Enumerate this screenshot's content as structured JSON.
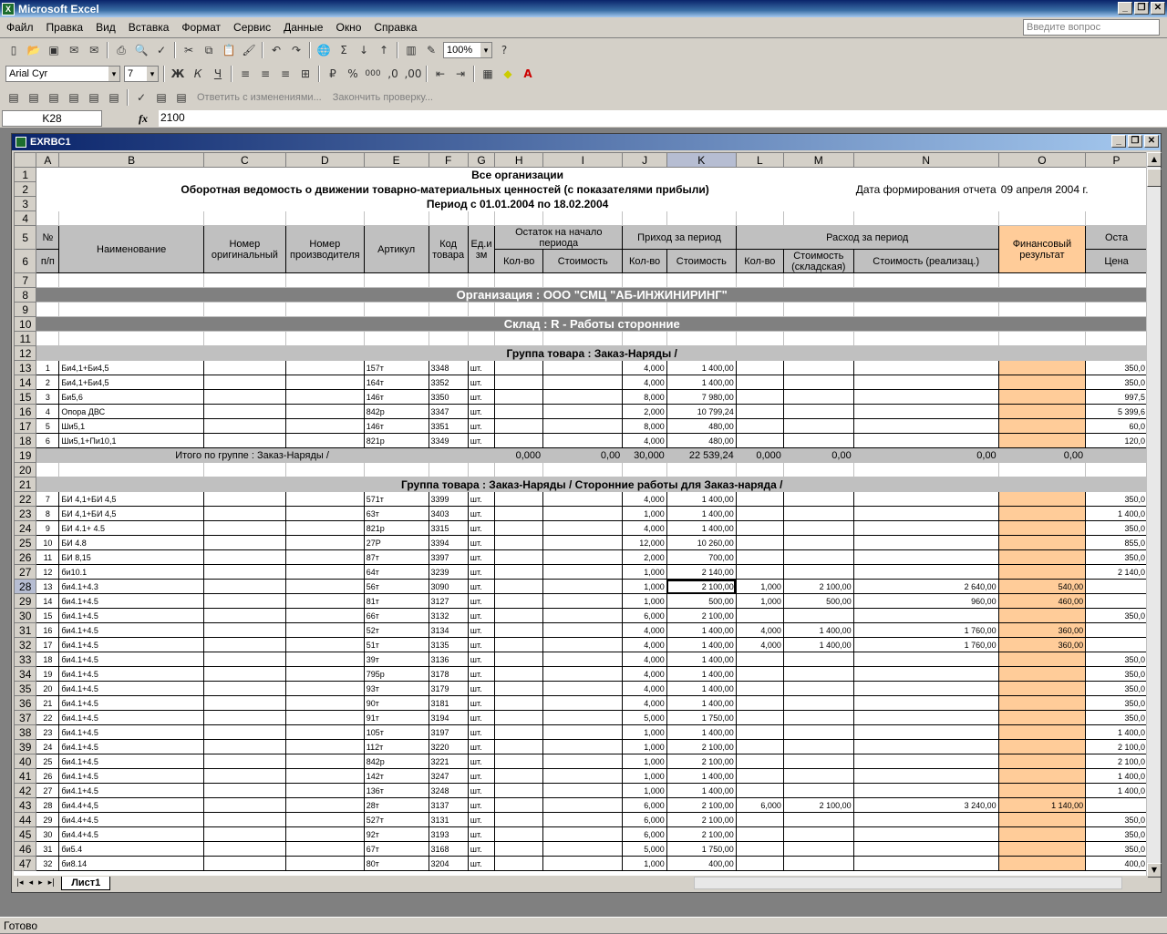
{
  "app": {
    "title": "Microsoft Excel",
    "doc_title": "EXRBC1",
    "status": "Готово",
    "ask_placeholder": "Введите вопрос"
  },
  "menu": [
    "Файл",
    "Правка",
    "Вид",
    "Вставка",
    "Формат",
    "Сервис",
    "Данные",
    "Окно",
    "Справка"
  ],
  "toolbar": {
    "zoom": "100%",
    "font": "Arial Cyr",
    "size": "7",
    "review_reply": "Ответить с изменениями...",
    "review_end": "Закончить проверку..."
  },
  "formula": {
    "cell": "K28",
    "value": "2100",
    "fx": "fx"
  },
  "columns": [
    "A",
    "B",
    "C",
    "D",
    "E",
    "F",
    "G",
    "H",
    "I",
    "J",
    "K",
    "L",
    "M",
    "N",
    "O",
    "P"
  ],
  "sheet_tab": "Лист1",
  "header": {
    "r1": "Все организации",
    "r2": "Оборотная ведомость о движении товарно-материальных ценностей (с показателями прибыли)",
    "r2_date_label": "Дата формирования отчета",
    "r2_date": "09 апреля 2004 г.",
    "r3": "Период с 01.01.2004 по 18.02.2004",
    "no": "№",
    "pp": "п/п",
    "name": "Наименование",
    "orig": "Номер оригинальный",
    "mfr": "Номер производителя",
    "art": "Артикул",
    "code": "Код товара",
    "unit": "Ед.и зм",
    "start": "Остаток на начало периода",
    "in": "Приход за период",
    "out": "Расход за период",
    "fin": "Финансовый результат",
    "end": "Оста",
    "qty": "Кол-во",
    "cost": "Стоимость",
    "cost_wh": "Стоимость (складская)",
    "cost_real": "Стоимость (реализац.)",
    "price": "Цена"
  },
  "org": "Организация : ООО \"СМЦ \"АБ-ИНЖИНИРИНГ\"",
  "warehouse": "Склад : R - Работы сторонние",
  "group1": "Группа товара : Заказ-Наряды /",
  "group2": "Группа товара : Заказ-Наряды / Сторонние работы для Заказ-наряда /",
  "total1": {
    "label": "Итого по группе : Заказ-Наряды /",
    "h": "0,000",
    "i": "0,00",
    "j": "30,000",
    "k": "22 539,24",
    "l": "0,000",
    "m": "0,00",
    "n": "0,00",
    "o": "0,00"
  },
  "rows1": [
    [
      "1",
      "Би4,1+Би4,5",
      "157т",
      "3348",
      "шт.",
      "4,000",
      "1 400,00",
      "",
      "",
      "",
      "",
      "350,0"
    ],
    [
      "2",
      "Би4,1+Би4,5",
      "164т",
      "3352",
      "шт.",
      "4,000",
      "1 400,00",
      "",
      "",
      "",
      "",
      "350,0"
    ],
    [
      "3",
      "Би5,6",
      "146т",
      "3350",
      "шт.",
      "8,000",
      "7 980,00",
      "",
      "",
      "",
      "",
      "997,5"
    ],
    [
      "4",
      "Опора ДВС",
      "842р",
      "3347",
      "шт.",
      "2,000",
      "10 799,24",
      "",
      "",
      "",
      "",
      "5 399,6"
    ],
    [
      "5",
      "Ши5,1",
      "146т",
      "3351",
      "шт.",
      "8,000",
      "480,00",
      "",
      "",
      "",
      "",
      "60,0"
    ],
    [
      "6",
      "Ши5,1+Пи10,1",
      "821р",
      "3349",
      "шт.",
      "4,000",
      "480,00",
      "",
      "",
      "",
      "",
      "120,0"
    ]
  ],
  "rows2": [
    [
      "7",
      "БИ 4,1+БИ 4,5",
      "571т",
      "3399",
      "шт.",
      "4,000",
      "1 400,00",
      "",
      "",
      "",
      "",
      "350,0"
    ],
    [
      "8",
      "БИ 4,1+БИ 4,5",
      "63т",
      "3403",
      "шт.",
      "1,000",
      "1 400,00",
      "",
      "",
      "",
      "",
      "1 400,0"
    ],
    [
      "9",
      "БИ 4.1+ 4.5",
      "821р",
      "3315",
      "шт.",
      "4,000",
      "1 400,00",
      "",
      "",
      "",
      "",
      "350,0"
    ],
    [
      "10",
      "БИ 4.8",
      "27Р",
      "3394",
      "шт.",
      "12,000",
      "10 260,00",
      "",
      "",
      "",
      "",
      "855,0"
    ],
    [
      "11",
      "БИ 8,15",
      "87т",
      "3397",
      "шт.",
      "2,000",
      "700,00",
      "",
      "",
      "",
      "",
      "350,0"
    ],
    [
      "12",
      "би10.1",
      "64т",
      "3239",
      "шт.",
      "1,000",
      "2 140,00",
      "",
      "",
      "",
      "",
      "2 140,0"
    ],
    [
      "13",
      "би4.1+4.3",
      "56т",
      "3090",
      "шт.",
      "1,000",
      "2 100,00",
      "1,000",
      "2 100,00",
      "2 640,00",
      "540,00",
      ""
    ],
    [
      "14",
      "би4.1+4.5",
      "81т",
      "3127",
      "шт.",
      "1,000",
      "500,00",
      "1,000",
      "500,00",
      "960,00",
      "460,00",
      ""
    ],
    [
      "15",
      "би4.1+4.5",
      "66т",
      "3132",
      "шт.",
      "6,000",
      "2 100,00",
      "",
      "",
      "",
      "",
      "350,0"
    ],
    [
      "16",
      "би4.1+4.5",
      "52т",
      "3134",
      "шт.",
      "4,000",
      "1 400,00",
      "4,000",
      "1 400,00",
      "1 760,00",
      "360,00",
      ""
    ],
    [
      "17",
      "би4.1+4.5",
      "51т",
      "3135",
      "шт.",
      "4,000",
      "1 400,00",
      "4,000",
      "1 400,00",
      "1 760,00",
      "360,00",
      ""
    ],
    [
      "18",
      "би4.1+4.5",
      "39т",
      "3136",
      "шт.",
      "4,000",
      "1 400,00",
      "",
      "",
      "",
      "",
      "350,0"
    ],
    [
      "19",
      "би4.1+4.5",
      "795р",
      "3178",
      "шт.",
      "4,000",
      "1 400,00",
      "",
      "",
      "",
      "",
      "350,0"
    ],
    [
      "20",
      "би4.1+4.5",
      "93т",
      "3179",
      "шт.",
      "4,000",
      "1 400,00",
      "",
      "",
      "",
      "",
      "350,0"
    ],
    [
      "21",
      "би4.1+4.5",
      "90т",
      "3181",
      "шт.",
      "4,000",
      "1 400,00",
      "",
      "",
      "",
      "",
      "350,0"
    ],
    [
      "22",
      "би4.1+4.5",
      "91т",
      "3194",
      "шт.",
      "5,000",
      "1 750,00",
      "",
      "",
      "",
      "",
      "350,0"
    ],
    [
      "23",
      "би4.1+4.5",
      "105т",
      "3197",
      "шт.",
      "1,000",
      "1 400,00",
      "",
      "",
      "",
      "",
      "1 400,0"
    ],
    [
      "24",
      "би4.1+4.5",
      "112т",
      "3220",
      "шт.",
      "1,000",
      "2 100,00",
      "",
      "",
      "",
      "",
      "2 100,0"
    ],
    [
      "25",
      "би4.1+4.5",
      "842р",
      "3221",
      "шт.",
      "1,000",
      "2 100,00",
      "",
      "",
      "",
      "",
      "2 100,0"
    ],
    [
      "26",
      "би4.1+4.5",
      "142т",
      "3247",
      "шт.",
      "1,000",
      "1 400,00",
      "",
      "",
      "",
      "",
      "1 400,0"
    ],
    [
      "27",
      "би4.1+4.5",
      "136т",
      "3248",
      "шт.",
      "1,000",
      "1 400,00",
      "",
      "",
      "",
      "",
      "1 400,0"
    ],
    [
      "28",
      "би4.4+4,5",
      "28т",
      "3137",
      "шт.",
      "6,000",
      "2 100,00",
      "6,000",
      "2 100,00",
      "3 240,00",
      "1 140,00",
      ""
    ],
    [
      "29",
      "би4.4+4.5",
      "527т",
      "3131",
      "шт.",
      "6,000",
      "2 100,00",
      "",
      "",
      "",
      "",
      "350,0"
    ],
    [
      "30",
      "би4.4+4.5",
      "92т",
      "3193",
      "шт.",
      "6,000",
      "2 100,00",
      "",
      "",
      "",
      "",
      "350,0"
    ],
    [
      "31",
      "би5.4",
      "67т",
      "3168",
      "шт.",
      "5,000",
      "1 750,00",
      "",
      "",
      "",
      "",
      "350,0"
    ],
    [
      "32",
      "би8.14",
      "80т",
      "3204",
      "шт.",
      "1,000",
      "400,00",
      "",
      "",
      "",
      "",
      "400,0"
    ]
  ]
}
